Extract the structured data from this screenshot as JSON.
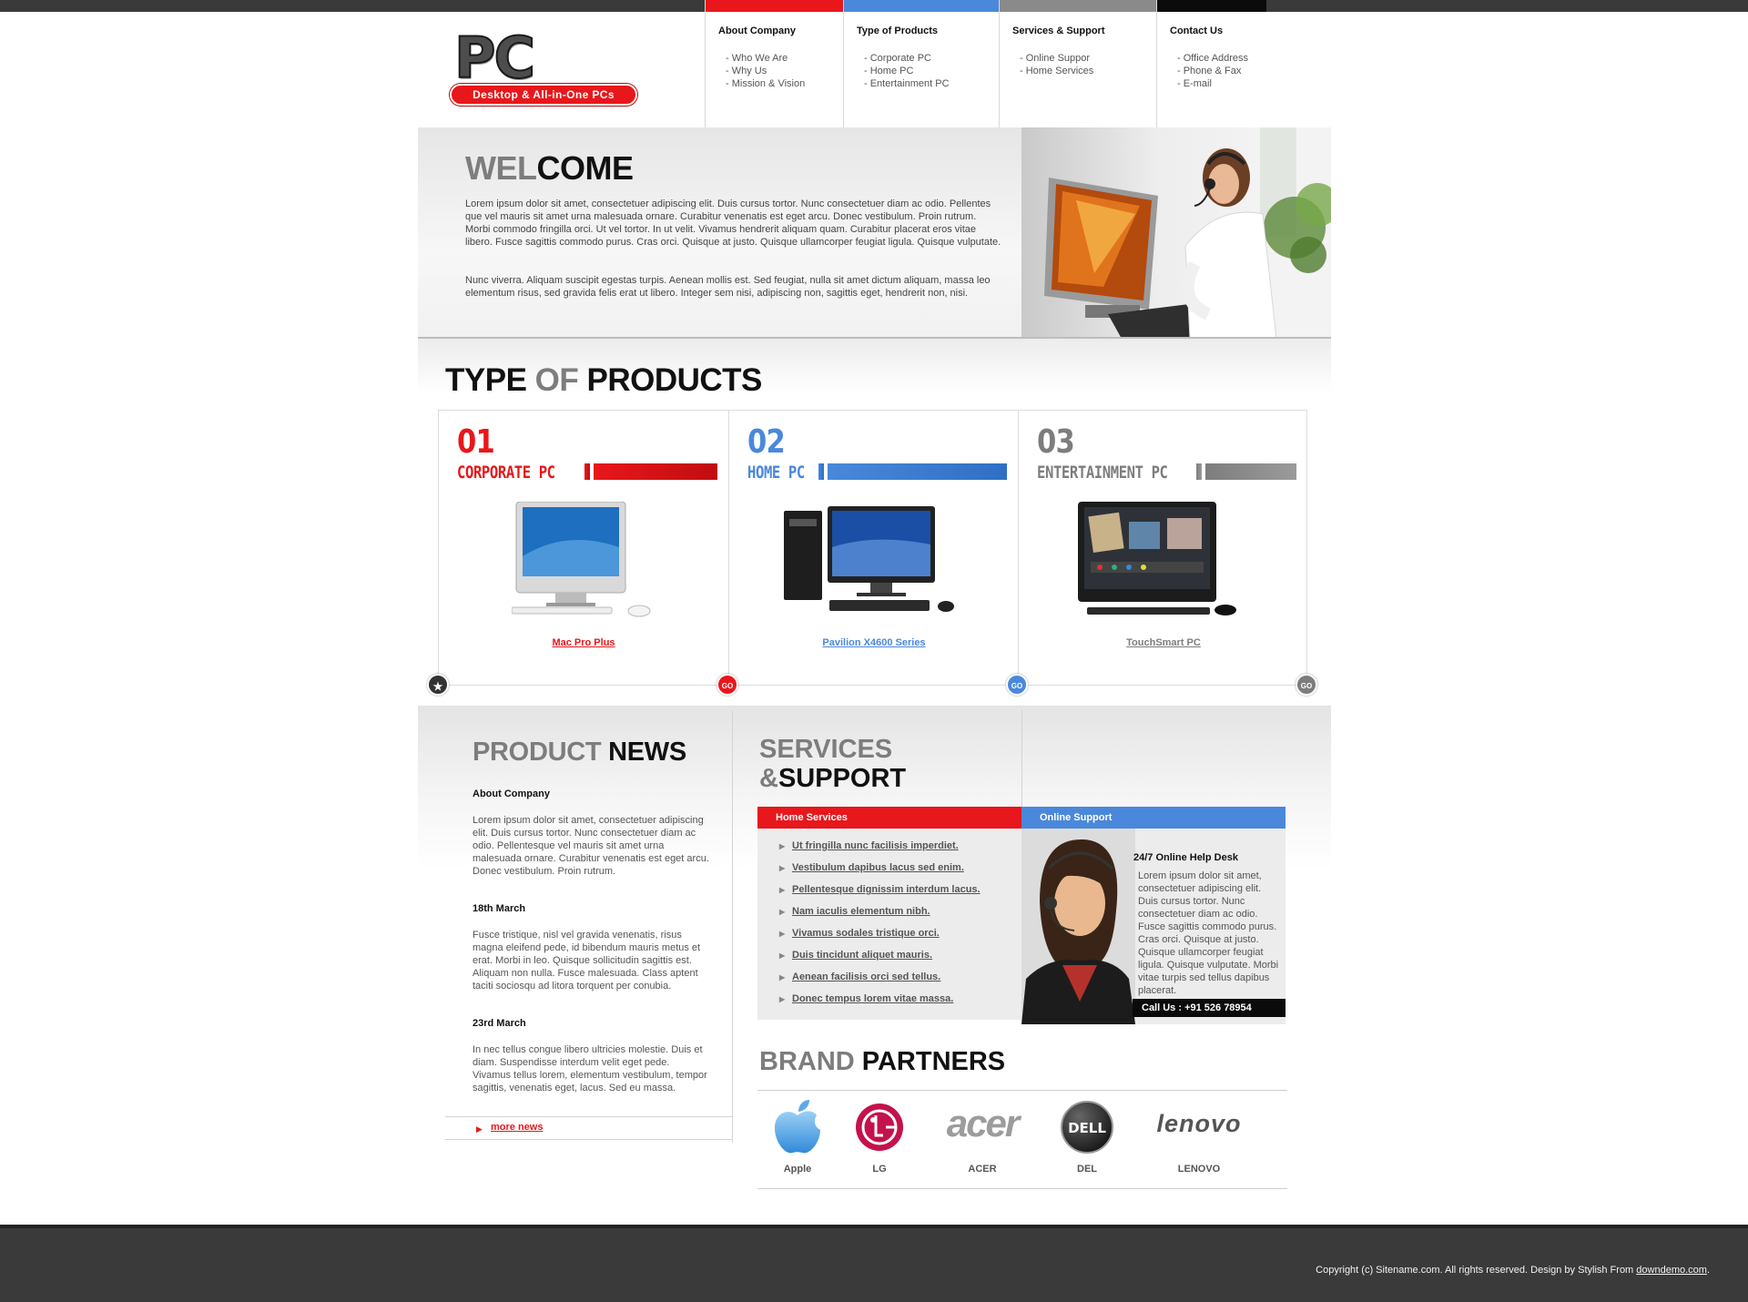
{
  "logo": {
    "wordmark": "PC",
    "tagline": "Desktop & All-in-One PCs"
  },
  "nav": [
    {
      "title": "About Company",
      "color": "#e8171b",
      "items": [
        "- Who We Are",
        "- Why Us",
        "- Mission & Vision"
      ]
    },
    {
      "title": "Type of Products",
      "color": "#4a88db",
      "items": [
        "- Corporate PC",
        "- Home PC",
        "- Entertainment PC"
      ]
    },
    {
      "title": "Services & Support",
      "color": "#8a8a8a",
      "items": [
        "- Online Suppor",
        "- Home Services"
      ]
    },
    {
      "title": "Contact Us",
      "color": "#0b0b0b",
      "items": [
        "- Office Address",
        "- Phone & Fax",
        "- E-mail"
      ]
    }
  ],
  "welcome": {
    "title_a": "WEL",
    "title_b": "COME",
    "p1": "Lorem ipsum dolor sit amet, consectetuer adipiscing elit. Duis cursus tortor. Nunc consectetuer diam ac odio. Pellentes que vel mauris sit amet urna malesuada ornare. Curabitur venenatis est eget arcu. Donec vestibulum. Proin rutrum. Morbi commodo fringilla orci. Ut vel tortor. In ut velit. Vivamus hendrerit aliquam quam. Curabitur placerat eros vitae libero. Fusce sagittis commodo purus. Cras orci. Quisque at justo. Quisque ullamcorper feugiat ligula. Quisque vulputate.",
    "p2": "Nunc viverra. Aliquam suscipit egestas turpis. Aenean mollis est. Sed feugiat, nulla sit amet dictum aliquam, massa leo elementum risus, sed gravida felis erat ut libero. Integer sem nisi, adipiscing non, sagittis eget, hendrerit non, nisi."
  },
  "products": {
    "title_a": "TYPE",
    "title_b": "OF",
    "title_c": "PRODUCTS",
    "cards": [
      {
        "num": "01",
        "name": "CORPORATE PC",
        "link": "Mac Pro Plus",
        "color": "#e8171b"
      },
      {
        "num": "02",
        "name": "HOME PC",
        "link": "Pavilion X4600 Series",
        "color": "#4a88db"
      },
      {
        "num": "03",
        "name": "ENTERTAINMENT PC",
        "link": "TouchSmart PC",
        "color": "#7d7d7d"
      }
    ],
    "go_label": "GO"
  },
  "news": {
    "title_a": "PRODUCT",
    "title_b": "NEWS",
    "items": [
      {
        "heading": "About Company",
        "text": "Lorem ipsum dolor sit amet, consectetuer adipiscing elit. Duis cursus tortor. Nunc consectetuer diam ac odio. Pellentesque vel mauris sit amet urna malesuada ornare. Curabitur venenatis est eget arcu. Donec vestibulum. Proin rutrum."
      },
      {
        "heading": "18th March",
        "text": "Fusce tristique, nisl vel gravida venenatis, risus magna eleifend pede, id bibendum mauris metus et erat. Morbi in leo. Quisque sollicitudin sagittis est. Aliquam non nulla. Fusce malesuada. Class aptent taciti sociosqu ad litora torquent per conubia."
      },
      {
        "heading": "23rd March",
        "text": "In nec tellus congue libero ultricies molestie. Duis et diam. Suspendisse interdum velit eget pede. Vivamus tellus lorem, elementum vestibulum, tempor sagittis, venenatis eget, lacus. Sed eu massa."
      }
    ],
    "more": "more news"
  },
  "services": {
    "title_a": "SERVICES",
    "title_b": "&",
    "title_c": "SUPPORT",
    "home_tab": "Home Services",
    "online_tab": "Online Support",
    "links": [
      "Ut fringilla nunc facilisis imperdiet.",
      "Vestibulum dapibus lacus sed enim.",
      "Pellentesque dignissim interdum lacus.",
      "Nam iaculis elementum nibh.",
      "Vivamus sodales tristique orci.",
      "Duis tincidunt aliquet mauris.",
      "Aenean facilisis orci sed tellus.",
      "Donec tempus lorem vitae massa."
    ],
    "helpdesk_title": "24/7 Online Help Desk",
    "helpdesk_text": "Lorem ipsum dolor sit amet, consectetuer adipiscing elit. Duis cursus tortor. Nunc consectetuer diam ac odio. Fusce sagittis commodo purus. Cras orci. Quisque at justo. Quisque ullamcorper feugiat ligula. Quisque vulputate. Morbi vitae turpis sed tellus dapibus placerat.",
    "callus": "Call Us : +91 526 78954"
  },
  "brands": {
    "title_a": "BRAND",
    "title_b": "PARTNERS",
    "items": [
      {
        "name": "Apple",
        "logo": "apple-logo"
      },
      {
        "name": "LG",
        "logo": "lg-logo"
      },
      {
        "name": "ACER",
        "logo": "acer-logo",
        "mark": "acer"
      },
      {
        "name": "DEL",
        "logo": "dell-logo",
        "mark": "DELL"
      },
      {
        "name": "LENOVO",
        "logo": "lenovo-logo",
        "mark": "lenovo"
      }
    ]
  },
  "footer": {
    "copyright": "Copyright (c) Sitename.com. All rights reserved. Design by Stylish From",
    "link": "downdemo.com",
    "end": "."
  }
}
